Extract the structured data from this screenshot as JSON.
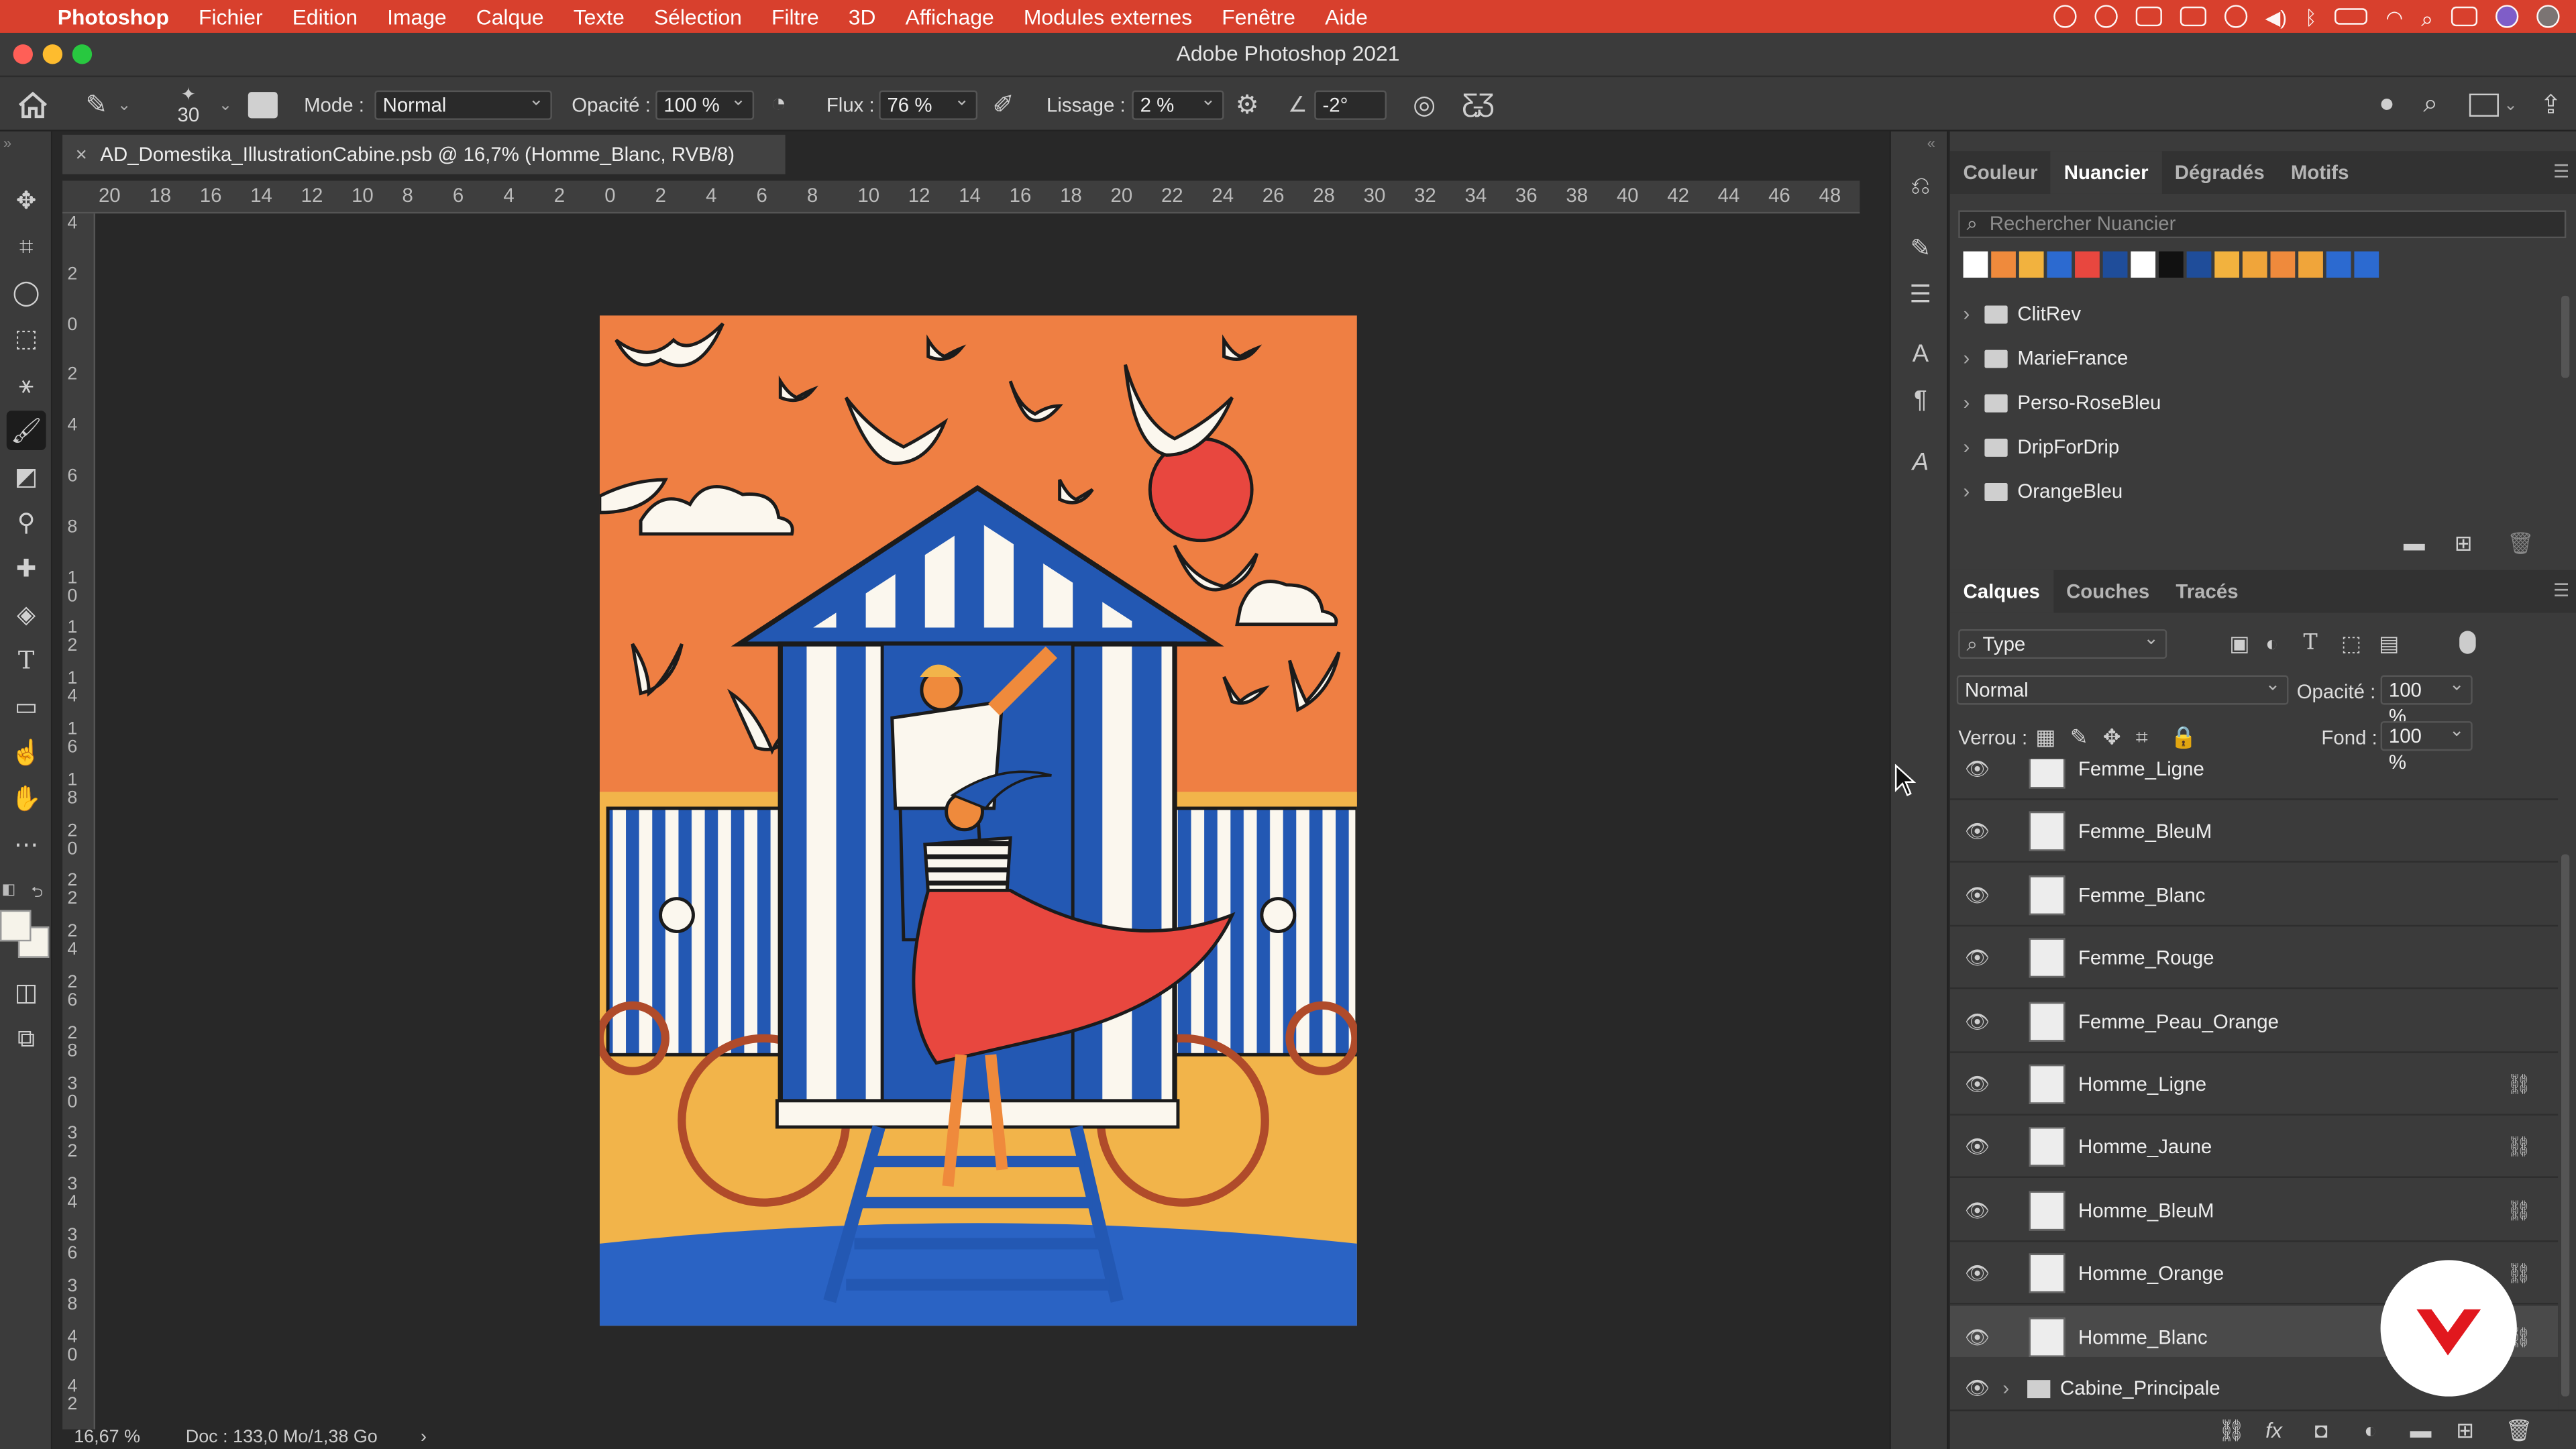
{
  "menubar": {
    "apple": "",
    "app": "Photoshop",
    "items": [
      "Fichier",
      "Edition",
      "Image",
      "Calque",
      "Texte",
      "Sélection",
      "Filtre",
      "3D",
      "Affichage",
      "Modules externes",
      "Fenêtre",
      "Aide"
    ]
  },
  "window": {
    "title": "Adobe Photoshop 2021"
  },
  "options": {
    "brush_size": "30",
    "mode_label": "Mode :",
    "mode_value": "Normal",
    "opacity_label": "Opacité :",
    "opacity_value": "100 %",
    "flow_label": "Flux :",
    "flow_value": "76 %",
    "smoothing_label": "Lissage :",
    "smoothing_value": "2 %",
    "angle_value": "-2°"
  },
  "document": {
    "tab_title": "AD_Domestika_IllustrationCabine.psb @ 16,7% (Homme_Blanc, RVB/8)",
    "close": "×"
  },
  "ruler": {
    "h_ticks": [
      "20",
      "18",
      "16",
      "14",
      "12",
      "10",
      "8",
      "6",
      "4",
      "2",
      "0",
      "2",
      "4",
      "6",
      "8",
      "10",
      "12",
      "14",
      "16",
      "18",
      "20",
      "22",
      "24",
      "26",
      "28",
      "30",
      "32",
      "34",
      "36",
      "38",
      "40",
      "42",
      "44",
      "46",
      "48"
    ],
    "v_ticks": [
      "4",
      "2",
      "0",
      "2",
      "4",
      "6",
      "8",
      "1\n0",
      "1\n2",
      "1\n4",
      "1\n6",
      "1\n8",
      "2\n0",
      "2\n2",
      "2\n4",
      "2\n6",
      "2\n8",
      "3\n0",
      "3\n2",
      "3\n4",
      "3\n6",
      "3\n8",
      "4\n0",
      "4\n2"
    ]
  },
  "status": {
    "zoom": "16,67 %",
    "doc": "Doc : 133,0 Mo/1,38 Go",
    "arrow": "›"
  },
  "swatches_panel": {
    "tabs": [
      "Couleur",
      "Nuancier",
      "Dégradés",
      "Motifs"
    ],
    "active": "Nuancier",
    "search_placeholder": "Rechercher Nuancier",
    "colors": [
      "#ffffff",
      "#ef8a3c",
      "#f2b23e",
      "#2c6ad0",
      "#e8473f",
      "#1f4d9a",
      "#ffffff",
      "#111111",
      "#1f4d9a",
      "#f2b23e",
      "#f0a53a",
      "#ef8a3c",
      "#f0a53a",
      "#2c6ad0",
      "#2c6ad0"
    ],
    "groups": [
      "ClitRev",
      "MarieFrance",
      "Perso-RoseBleu",
      "DripForDrip",
      "OrangeBleu"
    ]
  },
  "layers_panel": {
    "tabs": [
      "Calques",
      "Couches",
      "Tracés"
    ],
    "active": "Calques",
    "filter_value": "Type",
    "blend_value": "Normal",
    "opacity_label": "Opacité :",
    "opacity_value": "100 %",
    "lock_label": "Verrou :",
    "fill_label": "Fond :",
    "fill_value": "100 %",
    "layers": [
      {
        "name": "Femme_Ligne",
        "link": false
      },
      {
        "name": "Femme_BleuM",
        "link": false
      },
      {
        "name": "Femme_Blanc",
        "link": false
      },
      {
        "name": "Femme_Rouge",
        "link": false
      },
      {
        "name": "Femme_Peau_Orange",
        "link": false
      },
      {
        "name": "Homme_Ligne",
        "link": true
      },
      {
        "name": "Homme_Jaune",
        "link": true
      },
      {
        "name": "Homme_BleuM",
        "link": true
      },
      {
        "name": "Homme_Orange",
        "link": true
      },
      {
        "name": "Homme_Blanc",
        "link": true,
        "selected": true
      }
    ],
    "group": "Cabine_Principale"
  },
  "colors": {
    "menubar": "#d8402d",
    "sky": "#ef7f43",
    "sand": "#f2b44a",
    "blue": "#2358b3",
    "red": "#e8473f"
  }
}
